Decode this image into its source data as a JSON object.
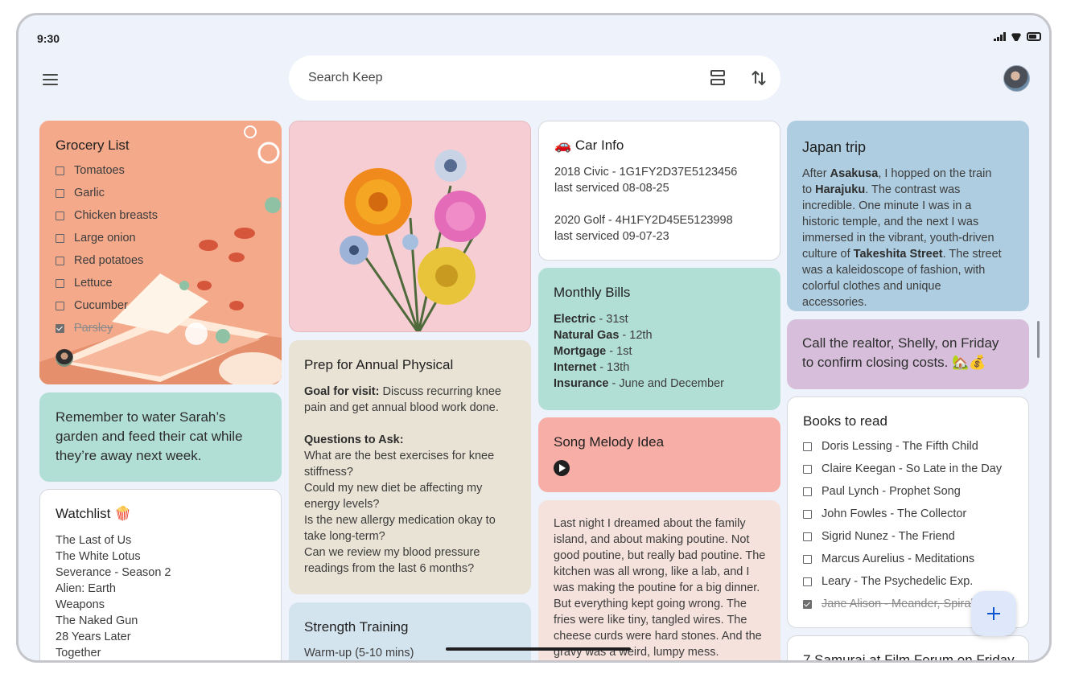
{
  "status": {
    "time": "9:30"
  },
  "search": {
    "placeholder": "Search Keep"
  },
  "colors": {
    "background": "#eef2fb",
    "grocery": "#f4a98a",
    "garden": "#b2dfd5",
    "physical": "#e9e3d6",
    "strength": "#d4e4ef",
    "bills": "#b2dfd5",
    "melody": "#f6aea6",
    "dream": "#f6e2dc",
    "japan": "#aecde0",
    "realtor": "#d7bfdc",
    "white": "#ffffff",
    "accent": "#0b57d0"
  },
  "notes": {
    "grocery": {
      "title": "Grocery List",
      "items": [
        {
          "label": "Tomatoes",
          "checked": false
        },
        {
          "label": "Garlic",
          "checked": false
        },
        {
          "label": "Chicken breasts",
          "checked": false
        },
        {
          "label": "Large onion",
          "checked": false
        },
        {
          "label": "Red potatoes",
          "checked": false
        },
        {
          "label": "Lettuce",
          "checked": false
        },
        {
          "label": "Cucumber",
          "checked": false
        },
        {
          "label": "Parsley",
          "checked": true
        }
      ]
    },
    "garden": {
      "text": "Remember to water Sarah’s garden and feed their cat while they’re away next week."
    },
    "watchlist": {
      "title": "Watchlist 🍿",
      "items": [
        "The Last of Us",
        "The White Lotus",
        "Severance - Season 2",
        "Alien: Earth",
        "Weapons",
        "The Naked Gun",
        "28 Years Later",
        "Together"
      ]
    },
    "physical": {
      "title": "Prep for Annual Physical",
      "goal_label": "Goal for visit:",
      "goal_text": " Discuss recurring knee pain and get annual blood work done.",
      "questions_label": "Questions to Ask:",
      "questions": [
        "What are the best exercises for knee stiffness?",
        "Could my new diet be affecting my energy levels?",
        "Is the new allergy medication okay to take long-term?",
        "Can we review my blood pressure readings from the last 6 months?"
      ]
    },
    "strength": {
      "title": "Strength Training",
      "first_line": "Warm-up (5-10 mins)"
    },
    "car": {
      "title": "🚗 Car Info",
      "line1": "2018 Civic - 1G1FY2D37E5123456",
      "line2": "last serviced 08-08-25",
      "line3": "2020 Golf - 4H1FY2D45E5123998",
      "line4": "last serviced 09-07-23"
    },
    "bills": {
      "title": "Monthly Bills",
      "rows": [
        {
          "label": "Electric",
          "value": " - 31st"
        },
        {
          "label": "Natural Gas",
          "value": " - 12th"
        },
        {
          "label": "Mortgage",
          "value": " - 1st"
        },
        {
          "label": "Internet",
          "value": " - 13th"
        },
        {
          "label": "Insurance",
          "value": " - June and December"
        }
      ]
    },
    "melody": {
      "title": "Song Melody Idea"
    },
    "dream": {
      "text": "Last night I dreamed about the family island, and about making poutine. Not good poutine, but really bad poutine. The kitchen was all wrong, like a lab, and I was making the poutine for a big dinner. But everything kept going wrong. The fries were like tiny, tangled wires. The cheese curds were hard stones. And the gravy was a weird, lumpy mess."
    },
    "japan": {
      "title": "Japan trip",
      "t1": "After ",
      "b1": "Asakusa",
      "t2": ", I hopped on the train to ",
      "b2": "Harajuku",
      "t3": ". The contrast was incredible. One minute I was in a historic temple, and the next I was immersed in the vibrant, youth-driven culture of ",
      "b3": "Takeshita Street",
      "t4": ". The street was a kaleidoscope of fashion, with colorful clothes and unique accessories."
    },
    "realtor": {
      "text": "Call the realtor, Shelly, on Friday to confirm closing costs. 🏡💰"
    },
    "books": {
      "title": "Books to read",
      "items": [
        {
          "label": "Doris Lessing - The Fifth Child",
          "checked": false
        },
        {
          "label": "Claire Keegan - So Late in the Day",
          "checked": false
        },
        {
          "label": "Paul Lynch - Prophet Song",
          "checked": false
        },
        {
          "label": "John Fowles - The Collector",
          "checked": false
        },
        {
          "label": "Sigrid Nunez - The Friend",
          "checked": false
        },
        {
          "label": "Marcus Aurelius - Meditations",
          "checked": false
        },
        {
          "label": "Leary - The Psychedelic Exp.",
          "checked": false
        },
        {
          "label": "Jane Alison - Meander, Spiral",
          "checked": true
        }
      ]
    },
    "samurai": {
      "title": "7 Samurai at Film Forum on Friday"
    }
  }
}
